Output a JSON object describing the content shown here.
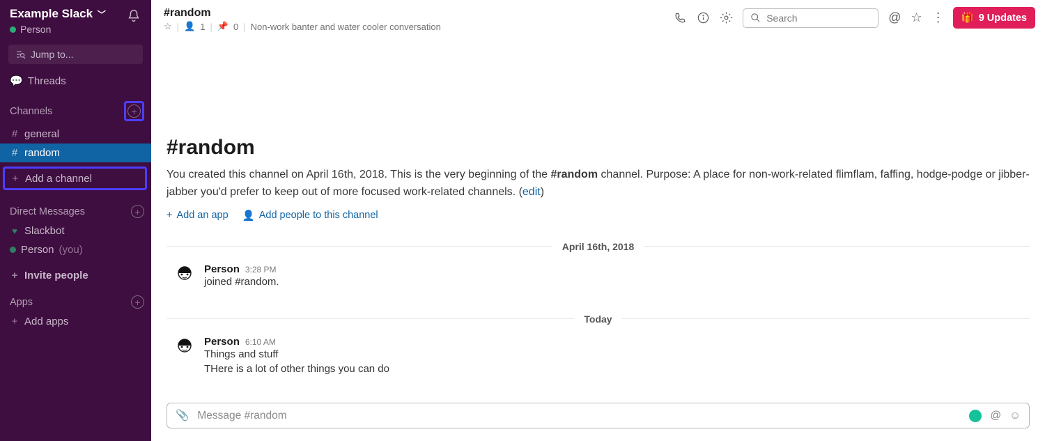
{
  "sidebar": {
    "workspace": "Example Slack",
    "user": "Person",
    "jump": "Jump to...",
    "threads": "Threads",
    "channels_heading": "Channels",
    "channels": [
      {
        "label": "general",
        "active": false
      },
      {
        "label": "random",
        "active": true
      }
    ],
    "add_channel": "Add a channel",
    "dm_heading": "Direct Messages",
    "dms": [
      {
        "label": "Slackbot",
        "kind": "heart"
      },
      {
        "label": "Person",
        "suffix": "(you)",
        "kind": "presence"
      }
    ],
    "invite": "Invite people",
    "apps_heading": "Apps",
    "add_apps": "Add apps"
  },
  "header": {
    "channel": "#random",
    "members": "1",
    "pins": "0",
    "topic": "Non-work banter and water cooler conversation",
    "search_placeholder": "Search",
    "updates": "9 Updates"
  },
  "intro": {
    "title": "#random",
    "text_pre": "You created this channel on April 16th, 2018. This is the very beginning of the ",
    "text_bold": "#random",
    "text_post": " channel. Purpose: A place for non-work-related flimflam, faffing, hodge-podge or jibber-jabber you'd prefer to keep out of more focused work-related channels. (",
    "edit": "edit",
    "text_close": ")",
    "add_app": "Add an app",
    "add_people": "Add people to this channel"
  },
  "days": [
    {
      "label": "April 16th, 2018",
      "messages": [
        {
          "user": "Person",
          "time": "3:28 PM",
          "lines": [
            "joined #random."
          ]
        }
      ]
    },
    {
      "label": "Today",
      "messages": [
        {
          "user": "Person",
          "time": "6:10 AM",
          "lines": [
            "Things and stuff",
            "THere is a lot of other things you can do"
          ]
        }
      ]
    }
  ],
  "composer": {
    "placeholder": "Message #random"
  }
}
